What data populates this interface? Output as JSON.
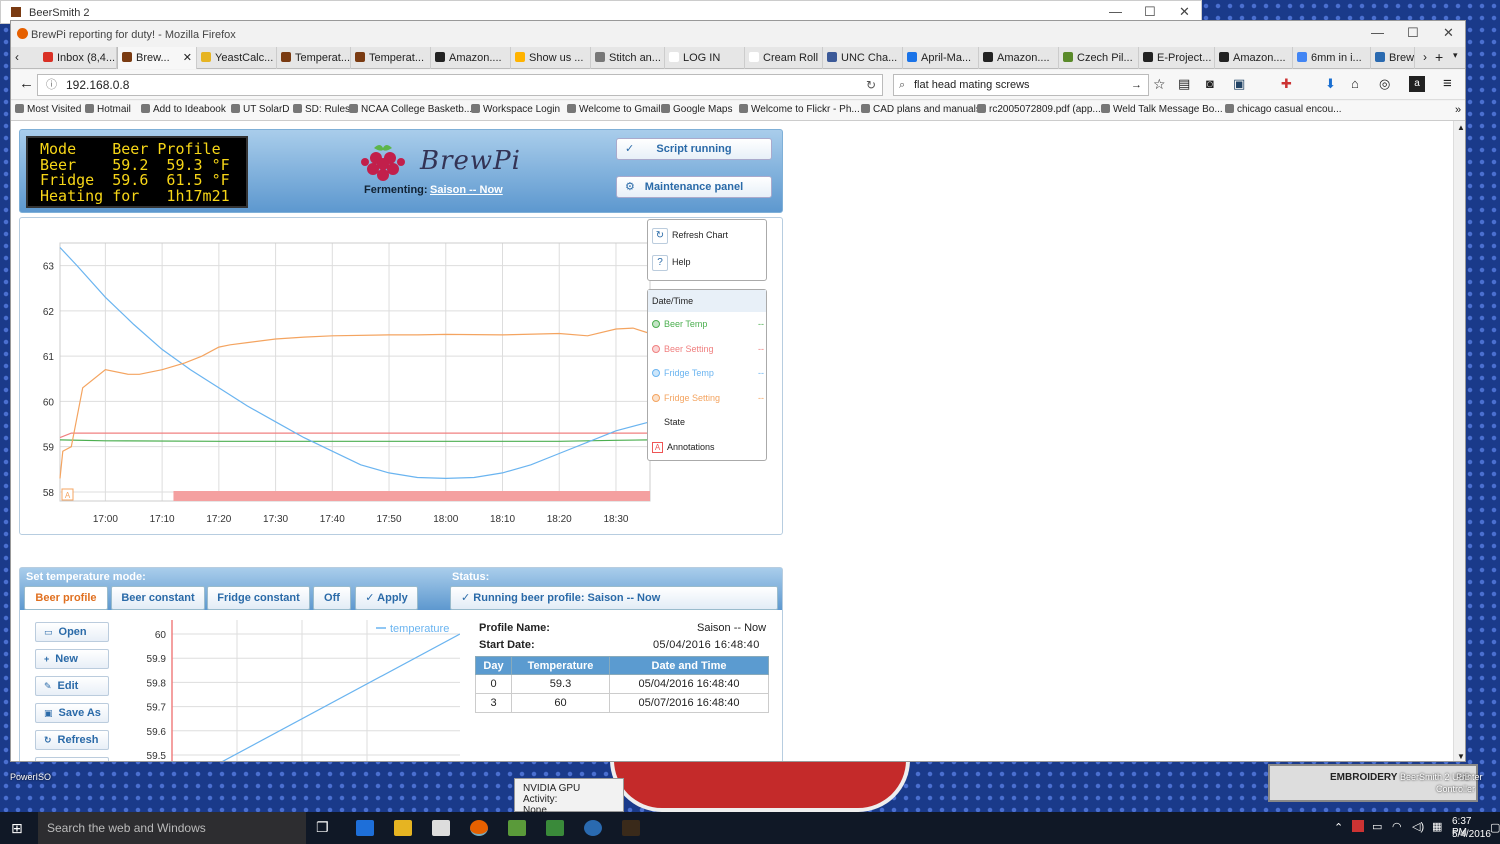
{
  "desktop": {
    "poweriso_label": "PowerISO",
    "embroid_label": "EMBROIDERY",
    "beersmith_usb_label": "BeerSmith 2 USB",
    "printer_label": "Printer",
    "controller_label": "Controller"
  },
  "beersmith": {
    "title": "BeerSmith 2"
  },
  "firefox": {
    "title": "BrewPi reporting for duty! - Mozilla Firefox",
    "tabs": [
      "Inbox (8,4...",
      "Brew...",
      "YeastCalc...",
      "Temperat...",
      "Temperat...",
      "Amazon....",
      "Show us ...",
      "Stitch an...",
      "LOG IN",
      "Cream Roll F...",
      "UNC Cha...",
      "April-Ma...",
      "Amazon....",
      "Czech Pil...",
      "E-Project...",
      "Amazon....",
      "6mm in i...",
      "Brewi"
    ],
    "url": "192.168.0.8",
    "search": "flat head mating screws",
    "bookmarks": [
      "Most Visited",
      "Hotmail",
      "Add to Ideabook",
      "UT SolarD",
      "SD: Rules",
      "NCAA College Basketb...",
      "Workspace Login",
      "Welcome to Gmail",
      "Google Maps",
      "Welcome to Flickr - Ph...",
      "CAD plans and manuals",
      "rc2005072809.pdf (app...",
      "Weld Talk Message Bo...",
      "chicago casual encou..."
    ]
  },
  "lcd": {
    "line1": "Mode    Beer Profile",
    "line2": "Beer    59.2  59.3 °F",
    "line3": "Fridge  59.6  61.5 °F",
    "line4": "Heating for   1h17m21"
  },
  "header": {
    "logo_text": "BrewPi",
    "fermenting_label": "Fermenting:",
    "fermenting_value": "Saison -- Now",
    "script_btn": "Script running",
    "maint_btn": "Maintenance panel"
  },
  "chart_data": {
    "type": "line",
    "x_ticks": [
      "17:00",
      "17:10",
      "17:20",
      "17:30",
      "17:40",
      "17:50",
      "18:00",
      "18:10",
      "18:20",
      "18:30"
    ],
    "x_minutes": [
      0,
      10,
      20,
      30,
      40,
      50,
      60,
      70,
      80,
      90
    ],
    "ylim": [
      57.8,
      63.5
    ],
    "y_ticks": [
      58,
      59,
      60,
      61,
      62,
      63
    ],
    "series": [
      {
        "name": "Beer Temp",
        "color": "#4caf50",
        "x": [
          -8,
          0,
          20,
          40,
          60,
          70,
          80,
          90,
          96
        ],
        "y": [
          59.15,
          59.13,
          59.12,
          59.12,
          59.12,
          59.12,
          59.12,
          59.14,
          59.15
        ]
      },
      {
        "name": "Beer Setting",
        "color": "#f08080",
        "x": [
          -8,
          -6,
          0,
          20,
          40,
          60,
          80,
          96
        ],
        "y": [
          59.2,
          59.3,
          59.3,
          59.3,
          59.3,
          59.3,
          59.3,
          59.3
        ]
      },
      {
        "name": "Fridge Temp",
        "color": "#6ab4f0",
        "x": [
          -8,
          -5,
          0,
          5,
          10,
          15,
          20,
          25,
          30,
          35,
          40,
          45,
          50,
          55,
          60,
          65,
          70,
          75,
          80,
          85,
          90,
          96
        ],
        "y": [
          63.4,
          63.0,
          62.3,
          61.7,
          61.15,
          60.7,
          60.3,
          59.9,
          59.55,
          59.2,
          58.9,
          58.6,
          58.42,
          58.32,
          58.3,
          58.32,
          58.42,
          58.6,
          58.85,
          59.1,
          59.35,
          59.55
        ]
      },
      {
        "name": "Fridge Setting",
        "color": "#f4a460",
        "x": [
          -8,
          -7.5,
          -6,
          -4,
          0,
          4,
          6,
          10,
          14,
          17,
          20,
          22,
          25,
          30,
          35,
          40,
          50,
          55,
          60,
          70,
          80,
          85,
          90,
          93,
          96
        ],
        "y": [
          58.3,
          58.9,
          59.0,
          60.3,
          60.7,
          60.6,
          60.6,
          60.7,
          60.85,
          61.0,
          61.2,
          61.25,
          61.3,
          61.38,
          61.42,
          61.45,
          61.47,
          61.47,
          61.48,
          61.47,
          61.5,
          61.45,
          61.6,
          61.62,
          61.5
        ]
      }
    ],
    "state_bar": {
      "from": 12,
      "to": 96,
      "color": "#f4a0a0"
    },
    "annotation": "A"
  },
  "chart_ui": {
    "refresh": "Refresh Chart",
    "help": "Help",
    "legend_title": "Date/Time",
    "legend": [
      "Beer Temp",
      "Beer Setting",
      "Fridge Temp",
      "Fridge Setting",
      "State",
      "Annotations"
    ],
    "dash": "--"
  },
  "control": {
    "set_mode_label": "Set temperature mode:",
    "status_label": "Status:",
    "modes": [
      "Beer profile",
      "Beer constant",
      "Fridge constant",
      "Off"
    ],
    "apply": "Apply",
    "status_text": "Running beer profile: Saison -- Now",
    "side_buttons": [
      "Open",
      "New",
      "Edit",
      "Save As",
      "Refresh",
      "Help"
    ],
    "mini_legend": "temperature",
    "mini_yticks": [
      "60",
      "59.9",
      "59.8",
      "59.7",
      "59.6",
      "59.5"
    ],
    "profile_name_label": "Profile Name:",
    "profile_name": "Saison -- Now",
    "start_date_label": "Start Date:",
    "start_date": "05/04/2016 16:48:40",
    "table_headers": [
      "Day",
      "Temperature",
      "Date and Time"
    ],
    "table_rows": [
      [
        "0",
        "59.3",
        "05/04/2016 16:48:40"
      ],
      [
        "3",
        "60",
        "05/07/2016 16:48:40"
      ]
    ]
  },
  "taskbar": {
    "search": "Search the web and Windows",
    "time": "6:37 PM",
    "date": "5/4/2016"
  },
  "gpu_popup": {
    "title": "NVIDIA GPU Activity:",
    "value": "None"
  }
}
